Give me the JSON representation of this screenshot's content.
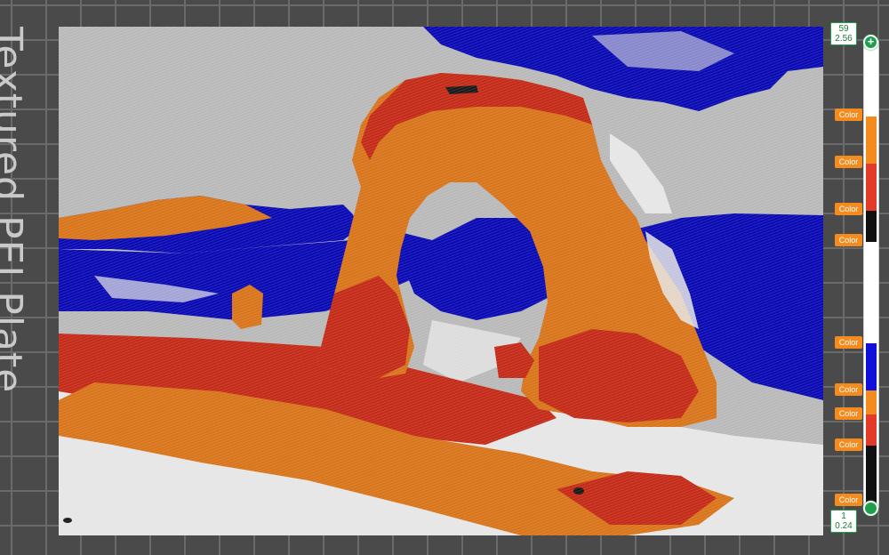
{
  "bed": {
    "label": "Textured PEI Plate"
  },
  "print_preview": {
    "subject": "arch",
    "palette": {
      "sky": "#b8b8b8",
      "blue": "#0a0ab4",
      "orange": "#d8741a",
      "red": "#c42a18",
      "white": "#e6e6e6",
      "black": "#1a1a1a"
    }
  },
  "layer_slider": {
    "top": {
      "layer": "59",
      "height": "2.56"
    },
    "bottom": {
      "layer": "1",
      "height": "0.24"
    },
    "color_change_label": "Color",
    "bands": [
      {
        "color": "#ffffff"
      },
      {
        "color": "#f38b1f"
      },
      {
        "color": "#e23b2a"
      },
      {
        "color": "#111111"
      },
      {
        "color": "#ffffff"
      },
      {
        "color": "#1010d8"
      },
      {
        "color": "#f38b1f"
      },
      {
        "color": "#e23b2a"
      },
      {
        "color": "#111111"
      }
    ]
  },
  "colors": {
    "accent_green": "#1ea04a",
    "color_tag": "#f38b1f"
  }
}
